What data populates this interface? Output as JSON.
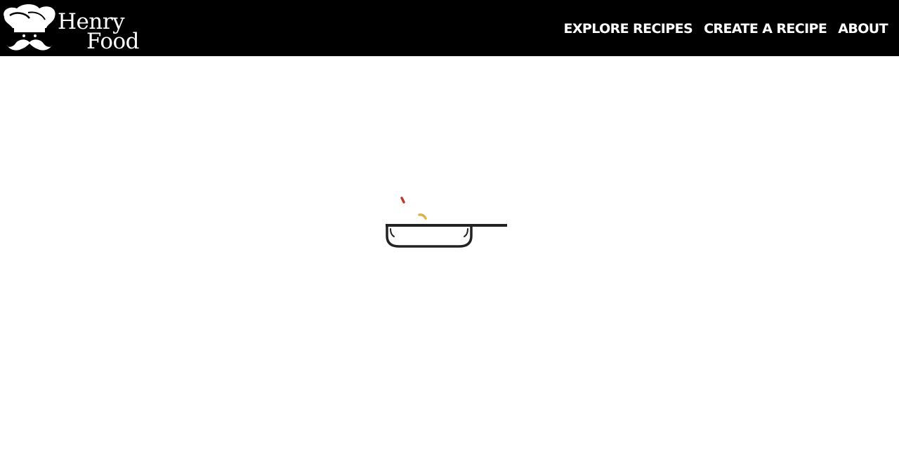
{
  "brand": {
    "line1": "Henry",
    "line2": "Food",
    "logo_icon": "chef-hat-mustache-icon"
  },
  "nav": {
    "items": [
      {
        "label": "EXPLORE RECIPES"
      },
      {
        "label": "CREATE A RECIPE"
      },
      {
        "label": "ABOUT"
      }
    ]
  },
  "loader": {
    "icon": "frying-pan-icon",
    "colors": {
      "pan": "#222222",
      "particle_red": "#c0392b",
      "particle_yellow": "#d9b44a"
    }
  },
  "theme": {
    "header_bg": "#000000",
    "header_text": "#ffffff",
    "page_bg": "#ffffff"
  }
}
